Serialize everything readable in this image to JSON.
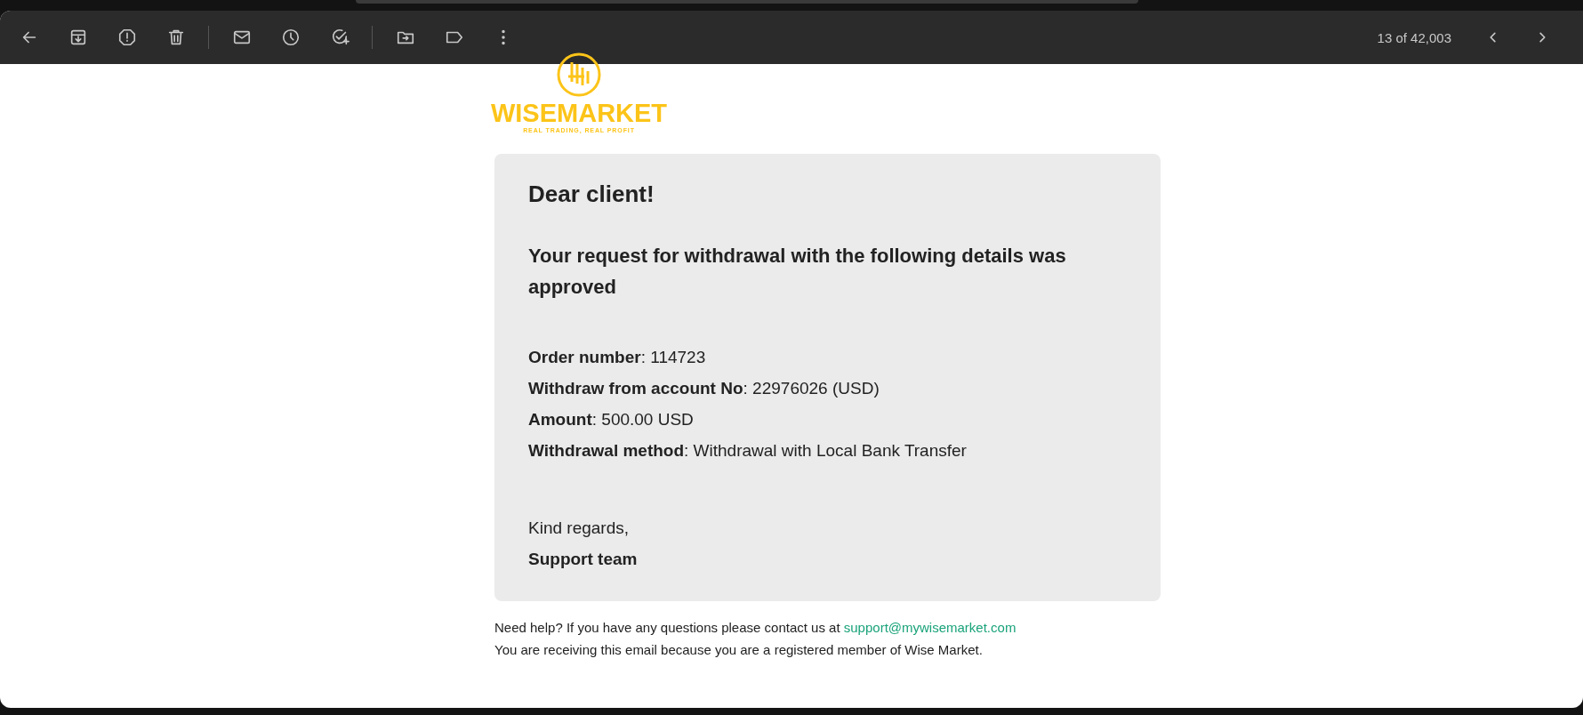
{
  "toolbar": {
    "counter": "13 of 42,003"
  },
  "logo": {
    "wordmark": "WISEMARKET",
    "tagline": "REAL TRADING, REAL PROFIT"
  },
  "message": {
    "greeting": "Dear client!",
    "heading": "Your request for withdrawal with the following details was approved",
    "details": [
      "**Order number**: 114723",
      "**Withdraw from account No**: 22976026 (USD)",
      "**Amount**: 500.00 USD",
      "**Withdrawal method**: Withdrawal with Local Bank Transfer"
    ],
    "closing": "Kind regards,",
    "signature": "Support team"
  },
  "footer": {
    "help_text": "Need help? If you have any questions please contact us at",
    "email_link": "support@mywisemarket.com",
    "notice": "You are receiving this email because you are a registered member of Wise Market."
  }
}
